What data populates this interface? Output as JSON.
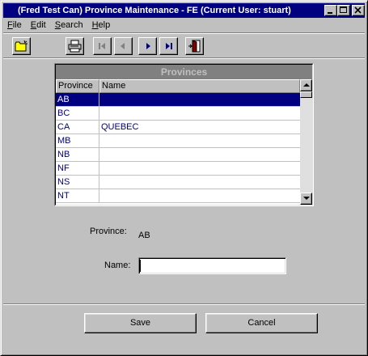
{
  "window": {
    "title": "(Fred Test Can) Province Maintenance - FE (Current User: stuart)"
  },
  "menu": [
    {
      "underline": "F",
      "rest": "ile"
    },
    {
      "underline": "E",
      "rest": "dit"
    },
    {
      "underline": "S",
      "rest": "earch"
    },
    {
      "underline": "H",
      "rest": "elp"
    }
  ],
  "toolbar": {
    "icons": [
      "new-folder-icon",
      "printer-icon",
      "first-record-icon",
      "previous-record-icon",
      "next-record-icon",
      "last-record-icon",
      "exit-door-icon"
    ]
  },
  "grid": {
    "caption": "Provinces",
    "columns": [
      "Province",
      "Name"
    ],
    "rows": [
      {
        "code": "AB",
        "name": ""
      },
      {
        "code": "BC",
        "name": ""
      },
      {
        "code": "CA",
        "name": "QUEBEC"
      },
      {
        "code": "MB",
        "name": ""
      },
      {
        "code": "NB",
        "name": ""
      },
      {
        "code": "NF",
        "name": ""
      },
      {
        "code": "NS",
        "name": ""
      },
      {
        "code": "NT",
        "name": ""
      }
    ],
    "selected_index": 0
  },
  "form": {
    "province_label": "Province:",
    "province_value": "AB",
    "name_label": "Name:",
    "name_value": ""
  },
  "buttons": {
    "save": "Save",
    "cancel": "Cancel"
  },
  "colors": {
    "title_bar": "#000080",
    "selected_row": "#000080",
    "face": "#c0c0c0"
  }
}
